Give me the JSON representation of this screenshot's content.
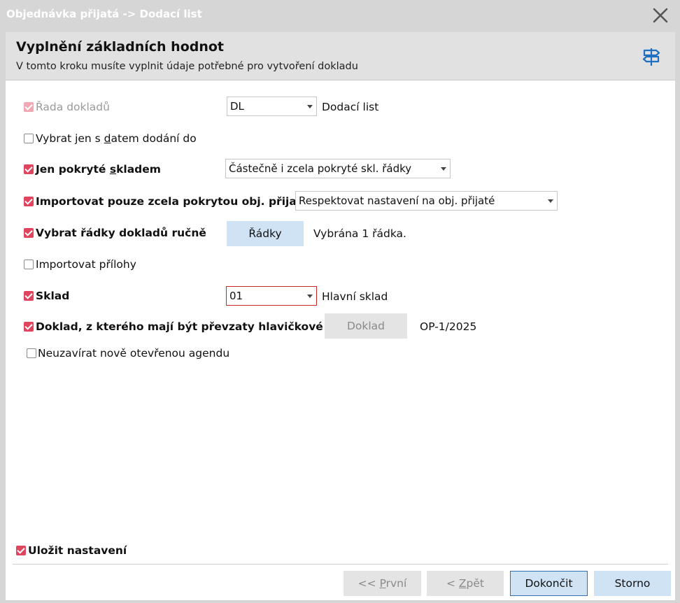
{
  "window": {
    "title": "Objednávka přijatá -> Dodací list"
  },
  "header": {
    "title": "Vyplnění základních hodnot",
    "subtitle": "V tomto kroku musíte vyplnit údaje potřebné pro vytvoření dokladu"
  },
  "form": {
    "rada": {
      "label": "Řada dokladů",
      "checked": true,
      "disabled": true,
      "select_value": "DL",
      "desc": "Dodací list"
    },
    "datum": {
      "label_pre": "Vybrat jen s ",
      "label_u": "d",
      "label_post": "atem dodání do",
      "checked": false
    },
    "pokryte": {
      "label_pre": "Jen pokryté ",
      "label_u": "s",
      "label_post": "kladem",
      "checked": true,
      "select_value": "Částečně i zcela pokryté skl. řádky"
    },
    "importovat_pokryte": {
      "label": "Importovat pouze zcela pokrytou obj. přijatou",
      "checked": true,
      "select_value": "Respektovat nastavení na obj. přijaté"
    },
    "radky": {
      "label": "Vybrat řádky dokladů ručně",
      "checked": true,
      "button": "Řádky",
      "info": "Vybrána 1 řádka."
    },
    "prilohy": {
      "label": "Importovat přílohy",
      "checked": false
    },
    "sklad": {
      "label": "Sklad",
      "checked": true,
      "select_value": "01",
      "desc": "Hlavní sklad"
    },
    "doklad": {
      "label": "Doklad, z kterého mají být převzaty hlavičkové údaje",
      "checked": true,
      "button": "Doklad",
      "value": "OP-1/2025"
    },
    "neuzavirat": {
      "label": "Neuzavírat nově otevřenou agendu",
      "checked": false
    }
  },
  "footer": {
    "ulozit": {
      "label": "Uložit nastavení",
      "checked": true
    },
    "buttons": {
      "prvni": {
        "pre": "<< ",
        "u": "P",
        "post": "rvní"
      },
      "zpet": {
        "pre": "< ",
        "u": "Z",
        "post": "pět"
      },
      "dokoncit": "Dokončit",
      "storno": "Storno"
    }
  },
  "colors": {
    "accent": "#e0455f",
    "button": "#cfe3f5",
    "header_bg": "#e1e1e1",
    "signpost_icon": "#1e6fc2"
  }
}
